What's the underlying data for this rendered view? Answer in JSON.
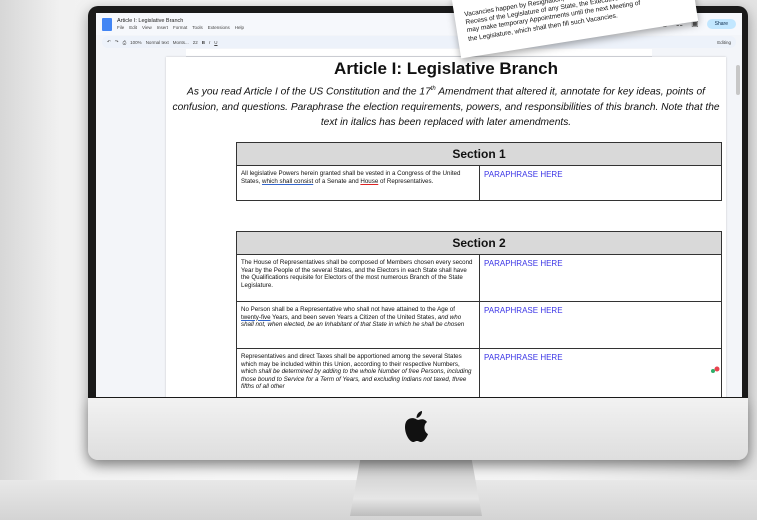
{
  "doc": {
    "title": "Article I: Legislative Branch",
    "menu": [
      "File",
      "Edit",
      "View",
      "Insert",
      "Format",
      "Tools",
      "Extensions",
      "Help"
    ],
    "share_label": "Share",
    "toolbar": {
      "zoom": "100%",
      "style": "Normal text",
      "font": "Monts...",
      "font_size": "22",
      "editing": "Editing"
    }
  },
  "page": {
    "heading": "Article I: Legislative Branch",
    "intro_part1": "As you read Article I of the US Constitution and the 17",
    "intro_sup": "th",
    "intro_part2": " Amendment that altered it, annotate for key ideas, points of confusion, and questions. Paraphrase the election requirements, powers, and responsibilities of this branch. Note that the text in italics has been replaced with later amendments.",
    "section1": {
      "title": "Section 1",
      "rows": [
        {
          "text_a": "All legislative Powers herein granted shall be vested in a Congress of the United States, ",
          "text_b": "which shall consist",
          "text_c": " of a Senate and ",
          "text_d": "House",
          "text_e": " of Representatives.",
          "paraphrase": "PARAPHRASE HERE"
        }
      ]
    },
    "section2": {
      "title": "Section 2",
      "rows": [
        {
          "text": "The House of Representatives shall be composed of Members chosen every second Year by the People of the several States, and the Electors in each State shall have the Qualifications requisite for Electors of the most numerous Branch of the State Legislature.",
          "paraphrase": "PARAPHRASE HERE"
        },
        {
          "text_a": "No Person shall be a Representative who shall not have attained to the Age of ",
          "text_b": "twenty-five",
          "text_c": " Years, and been seven Years a Citizen of the United States, ",
          "text_d": "and who shall not, when elected, be an Inhabitant of that State in which he shall be chosen",
          "paraphrase": "PARAPHRASE HERE"
        },
        {
          "text_a": "Representatives and direct Taxes shall be apportioned among the several States which may be included within this Union, according to their respective Numbers, which ",
          "text_b": "shall be determined by adding to the whole Number of free Persons, including those bound to Service for a Term of Years, and excluding Indians not taxed, three fifths of all other",
          "paraphrase": "PARAPHRASE HERE"
        }
      ]
    }
  },
  "note": {
    "line1": "Vacancies happen by Resignation, or otherwise, during the",
    "line2": "Recess of the Legislature of any State, the Executive thereof",
    "line3": "may make temporary Appointments until the next Meeting of",
    "line4": "the Legislature, which shall then fill such Vacancies."
  },
  "colors": {
    "paraphrase": "#3b35e6",
    "section_header_bg": "#d9d9d9",
    "share_bg": "#c2e7ff"
  }
}
